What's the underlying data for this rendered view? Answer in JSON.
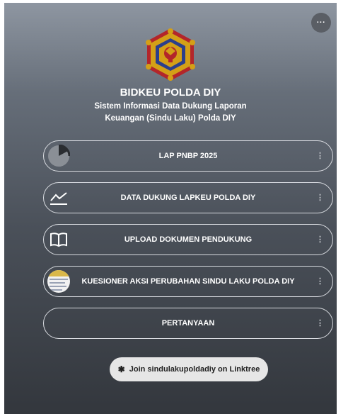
{
  "header": {
    "menu_label": "···",
    "title": "BIDKEU POLDA DIY",
    "subtitle_line1": "Sistem Informasi Data Dukung Laporan",
    "subtitle_line2": "Keuangan (Sindu Laku) Polda DIY"
  },
  "links": [
    {
      "label": "LAP PNBP 2025",
      "icon": "progress-circle-icon"
    },
    {
      "label": "DATA DUKUNG LAPKEU POLDA DIY",
      "icon": "chart-line-icon"
    },
    {
      "label": "UPLOAD DOKUMEN PENDUKUNG",
      "icon": "book-icon"
    },
    {
      "label": "KUESIONER AKSI PERUBAHAN SINDU LAKU POLDA DIY",
      "icon": "questionnaire-thumbnail"
    },
    {
      "label": "PERTANYAAN",
      "icon": ""
    }
  ],
  "footer": {
    "star": "✱",
    "join_text": "Join sindulakupoldadiy on Linktree"
  },
  "colors": {
    "gradient_top": "#8e96a1",
    "gradient_bottom": "#33373d",
    "logo_gold": "#d4a017",
    "logo_red": "#b3262a",
    "logo_blue": "#2b3f8c"
  }
}
